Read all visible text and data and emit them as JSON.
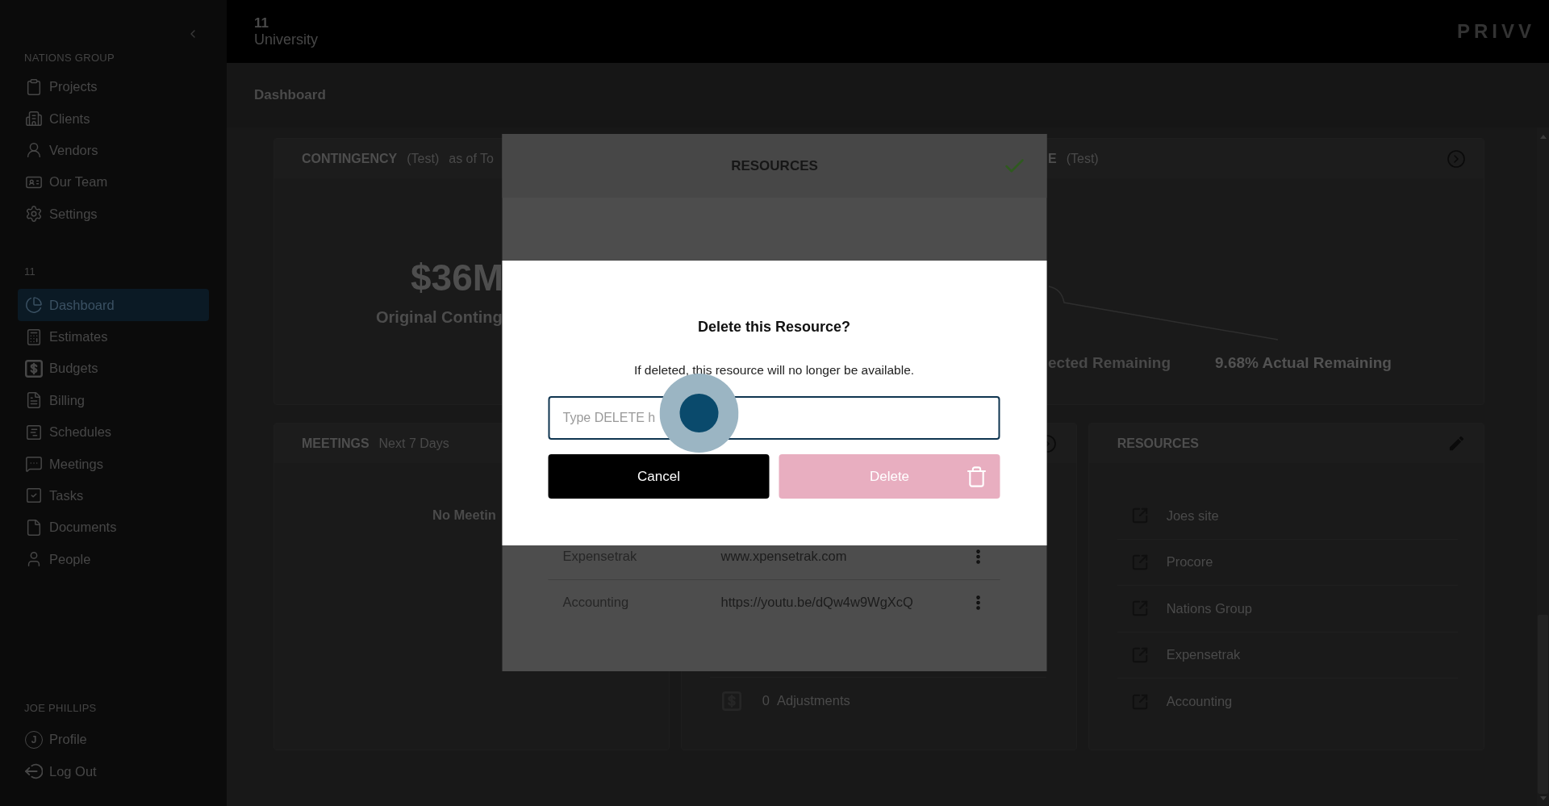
{
  "sidebar": {
    "sections": [
      {
        "label": "NATIONS GROUP",
        "items": [
          {
            "label": "Projects",
            "selected": false
          },
          {
            "label": "Clients",
            "selected": false
          },
          {
            "label": "Vendors",
            "selected": false
          },
          {
            "label": "Our Team",
            "selected": false
          },
          {
            "label": "Settings",
            "selected": false
          }
        ]
      },
      {
        "label": "11",
        "items": [
          {
            "label": "Dashboard",
            "selected": true
          },
          {
            "label": "Estimates",
            "selected": false
          },
          {
            "label": "Budgets",
            "selected": false
          },
          {
            "label": "Billing",
            "selected": false
          },
          {
            "label": "Schedules",
            "selected": false
          },
          {
            "label": "Meetings",
            "selected": false
          },
          {
            "label": "Tasks",
            "selected": false
          },
          {
            "label": "Documents",
            "selected": false
          },
          {
            "label": "People",
            "selected": false
          }
        ]
      }
    ],
    "user": {
      "label": "JOE PHILLIPS",
      "items": [
        {
          "kind": "avatar",
          "initial": "J",
          "label": "Profile",
          "selected": false
        },
        {
          "kind": "logout",
          "label": "Log Out",
          "selected": false
        }
      ]
    }
  },
  "header": {
    "project_number": "11",
    "project_name": "University",
    "logo": "PRIVV"
  },
  "page_title": "Dashboard",
  "contingency_card": {
    "title": "CONTINGENCY",
    "qualifier": "(Test)",
    "date_note": "as of To",
    "amount": "$36M",
    "amount_label": "Original Conting",
    "right_title": "E",
    "right_qualifier": "(Test)",
    "projected_label": "ected Remaining",
    "actual_label": "9.68% Actual Remaining"
  },
  "meetings_card": {
    "title": "MEETINGS",
    "subtitle": "Next 7 Days",
    "empty_message": "No Meetin"
  },
  "middle_card": {
    "count": "0",
    "label": "Adjustments"
  },
  "resources_card": {
    "title": "RESOURCES",
    "links": [
      {
        "label": "Joes site"
      },
      {
        "label": "Procore"
      },
      {
        "label": "Nations Group"
      },
      {
        "label": "Expensetrak"
      },
      {
        "label": "Accounting"
      }
    ]
  },
  "resources_modal": {
    "title": "RESOURCES",
    "rows": [
      {
        "name": "Expensetrak",
        "url": "www.xpensetrak.com"
      },
      {
        "name": "Accounting",
        "url": "https://youtu.be/dQw4w9WgXcQ"
      }
    ]
  },
  "delete_dialog": {
    "title": "Delete this Resource?",
    "message": "If deleted, this resource will no longer be available.",
    "input": {
      "placeholder": "Type DELETE h"
    },
    "buttons": [
      {
        "kind": "cancel",
        "label": "Cancel",
        "disabled": false
      },
      {
        "kind": "delete",
        "label": "Delete",
        "disabled": true
      }
    ]
  }
}
